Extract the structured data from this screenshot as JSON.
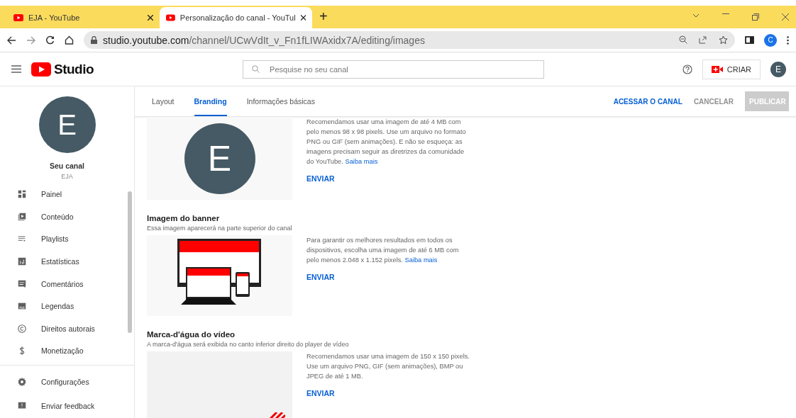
{
  "browser": {
    "tabs": [
      {
        "title": "EJA - YouTube",
        "selected": false
      },
      {
        "title": "Personalização do canal - YouTul",
        "selected": true
      }
    ],
    "new_tab": "+",
    "url_host": "studio.youtube.com",
    "url_path": "/channel/UCwVdIt_v_Fn1fLIWAxidx7A/editing/images",
    "profile": "C"
  },
  "header": {
    "logo": "Studio",
    "search_placeholder": "Pesquise no seu canal",
    "create": "CRIAR",
    "avatar": "E"
  },
  "sidebar": {
    "avatar": "E",
    "channel_label": "Seu canal",
    "channel_name": "EJA",
    "items": [
      {
        "kind": "dashboard",
        "label": "Painel"
      },
      {
        "kind": "content",
        "label": "Conteúdo"
      },
      {
        "kind": "playlist",
        "label": "Playlists"
      },
      {
        "kind": "stats",
        "label": "Estatísticas"
      },
      {
        "kind": "comments",
        "label": "Comentários"
      },
      {
        "kind": "subtitles",
        "label": "Legendas"
      },
      {
        "kind": "copyright",
        "label": "Direitos autorais"
      },
      {
        "kind": "money",
        "label": "Monetização"
      }
    ],
    "footer_items": [
      {
        "kind": "settings",
        "label": "Configurações"
      },
      {
        "kind": "feedback",
        "label": "Enviar feedback"
      }
    ]
  },
  "tabs": [
    {
      "label": "Layout",
      "selected": false
    },
    {
      "label": "Branding",
      "selected": true
    },
    {
      "label": "Informações básicas",
      "selected": false
    }
  ],
  "actions": {
    "view_channel": "ACESSAR O CANAL",
    "cancel": "CANCELAR",
    "publish": {
      "label": "PUBLICAR",
      "disabled": true
    }
  },
  "sections": [
    {
      "kind": "avatar",
      "avatar": "E",
      "description": "Recomendamos usar uma imagem de até 4 MB com pelo menos 98 x 98 pixels. Use um arquivo no formato PNG ou GIF (sem animações). E não se esqueça: as imagens precisam seguir as diretrizes da comunidade do YouTube.",
      "link": "Saiba mais",
      "button": "ENVIAR"
    },
    {
      "kind": "banner",
      "title": "Imagem do banner",
      "subtitle": "Essa imagem aparecerá na parte superior do canal",
      "description": "Para garantir os melhores resultados em todos os dispositivos, escolha uma imagem de até 6 MB com pelo menos 2.048 x 1.152 pixels.",
      "link": "Saiba mais",
      "button": "ENVIAR"
    },
    {
      "kind": "watermark",
      "title": "Marca-d'água do vídeo",
      "subtitle": "A marca-d'água será exibida no canto inferior direito do player de vídeo",
      "description": "Recomendamos usar uma imagem de 150 x 150 pixels. Use um arquivo PNG, GIF (sem animações), BMP ou JPEG de até 1 MB.",
      "button": "ENVIAR"
    }
  ]
}
